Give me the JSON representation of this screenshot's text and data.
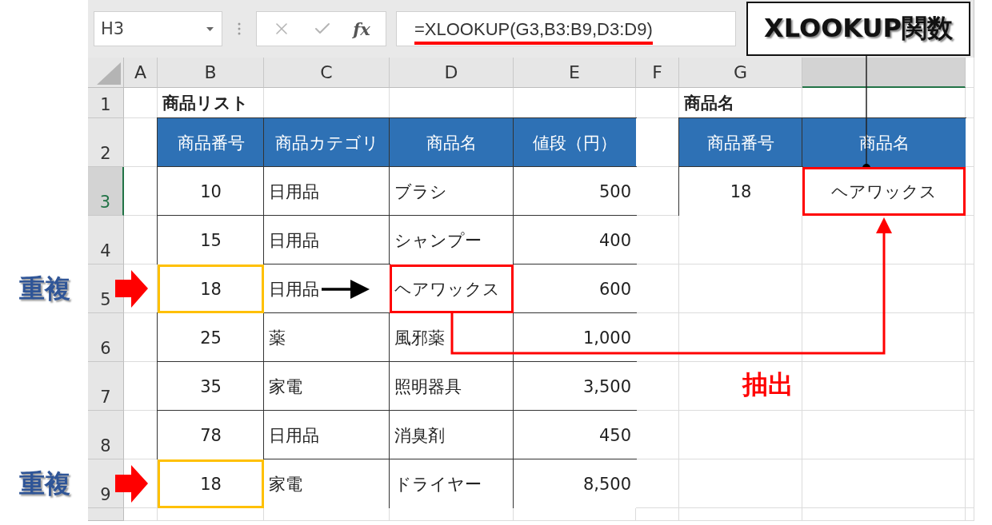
{
  "name_box": {
    "value": "H3"
  },
  "formula_bar": {
    "function_symbol": "fx",
    "formula": "=XLOOKUP(G3,B3:B9,D3:D9)"
  },
  "columns": [
    {
      "label": "A",
      "selected": false
    },
    {
      "label": "B",
      "selected": false
    },
    {
      "label": "C",
      "selected": false
    },
    {
      "label": "D",
      "selected": false
    },
    {
      "label": "E",
      "selected": false
    },
    {
      "label": "F",
      "selected": false
    },
    {
      "label": "G",
      "selected": false
    },
    {
      "selected": true
    }
  ],
  "rows": [
    {
      "header": "1",
      "selected": false,
      "cells": [
        {
          "kind": "blank"
        },
        {
          "kind": "title",
          "text": "商品リスト"
        },
        {
          "kind": "blank"
        },
        {
          "kind": "blank"
        },
        {
          "kind": "blank"
        },
        {
          "kind": "blank"
        },
        {
          "kind": "title",
          "text": "商品名"
        },
        {
          "kind": "blank"
        }
      ]
    },
    {
      "header": "2",
      "selected": false,
      "cells": [
        {
          "kind": "blank"
        },
        {
          "kind": "head",
          "text": "商品番号"
        },
        {
          "kind": "head",
          "text": "商品カテゴリ"
        },
        {
          "kind": "head",
          "text": "商品名"
        },
        {
          "kind": "head",
          "text": "値段（円）"
        },
        {
          "kind": "blank"
        },
        {
          "kind": "head",
          "text": "商品番号"
        },
        {
          "kind": "head",
          "text": "商品名"
        }
      ]
    },
    {
      "header": "3",
      "selected": true,
      "cells": [
        {
          "kind": "blank"
        },
        {
          "kind": "center",
          "text": "10"
        },
        {
          "kind": "left",
          "text": "日用品"
        },
        {
          "kind": "left",
          "text": "ブラシ"
        },
        {
          "kind": "right",
          "text": "500"
        },
        {
          "kind": "blank"
        },
        {
          "kind": "center",
          "text": "18"
        },
        {
          "kind": "center",
          "text": "ヘアワックス",
          "color": "#ff0000"
        }
      ]
    },
    {
      "header": "4",
      "selected": false,
      "cells": [
        {
          "kind": "blank"
        },
        {
          "kind": "center",
          "text": "15"
        },
        {
          "kind": "left",
          "text": "日用品"
        },
        {
          "kind": "left",
          "text": "シャンプー"
        },
        {
          "kind": "right",
          "text": "400"
        },
        {
          "kind": "blank"
        },
        {
          "kind": "blank"
        },
        {
          "kind": "blank"
        }
      ]
    },
    {
      "header": "5",
      "selected": false,
      "cells": [
        {
          "kind": "blank"
        },
        {
          "kind": "center",
          "text": "18",
          "color": "#ffc000"
        },
        {
          "kind": "left",
          "text": "日用品"
        },
        {
          "kind": "left",
          "text": "ヘアワックス",
          "color": "#ff0000"
        },
        {
          "kind": "right",
          "text": "600"
        },
        {
          "kind": "blank"
        },
        {
          "kind": "blank"
        },
        {
          "kind": "blank"
        }
      ]
    },
    {
      "header": "6",
      "selected": false,
      "cells": [
        {
          "kind": "blank"
        },
        {
          "kind": "center",
          "text": "25"
        },
        {
          "kind": "left",
          "text": "薬"
        },
        {
          "kind": "left",
          "text": "風邪薬"
        },
        {
          "kind": "right",
          "text": "1,000"
        },
        {
          "kind": "blank"
        },
        {
          "kind": "blank"
        },
        {
          "kind": "blank"
        }
      ]
    },
    {
      "header": "7",
      "selected": false,
      "cells": [
        {
          "kind": "blank"
        },
        {
          "kind": "center",
          "text": "35"
        },
        {
          "kind": "left",
          "text": "家電"
        },
        {
          "kind": "left",
          "text": "照明器具"
        },
        {
          "kind": "right",
          "text": "3,500"
        },
        {
          "kind": "blank"
        },
        {
          "kind": "blank"
        },
        {
          "kind": "blank"
        }
      ]
    },
    {
      "header": "8",
      "selected": false,
      "cells": [
        {
          "kind": "blank"
        },
        {
          "kind": "center",
          "text": "78"
        },
        {
          "kind": "left",
          "text": "日用品"
        },
        {
          "kind": "left",
          "text": "消臭剤"
        },
        {
          "kind": "right",
          "text": "450"
        },
        {
          "kind": "blank"
        },
        {
          "kind": "blank"
        },
        {
          "kind": "blank"
        }
      ]
    },
    {
      "header": "9",
      "selected": false,
      "cells": [
        {
          "kind": "blank"
        },
        {
          "kind": "center",
          "text": "18",
          "color": "#ffc000"
        },
        {
          "kind": "left",
          "text": "家電"
        },
        {
          "kind": "left",
          "text": "ドライヤー"
        },
        {
          "kind": "right",
          "text": "8,500"
        },
        {
          "kind": "blank"
        },
        {
          "kind": "blank"
        },
        {
          "kind": "blank"
        }
      ]
    }
  ],
  "annotations": {
    "function_label": "XLOOKUP関数",
    "duplicate_labels": [
      "重複",
      "重複"
    ],
    "extract_label": "抽出"
  }
}
